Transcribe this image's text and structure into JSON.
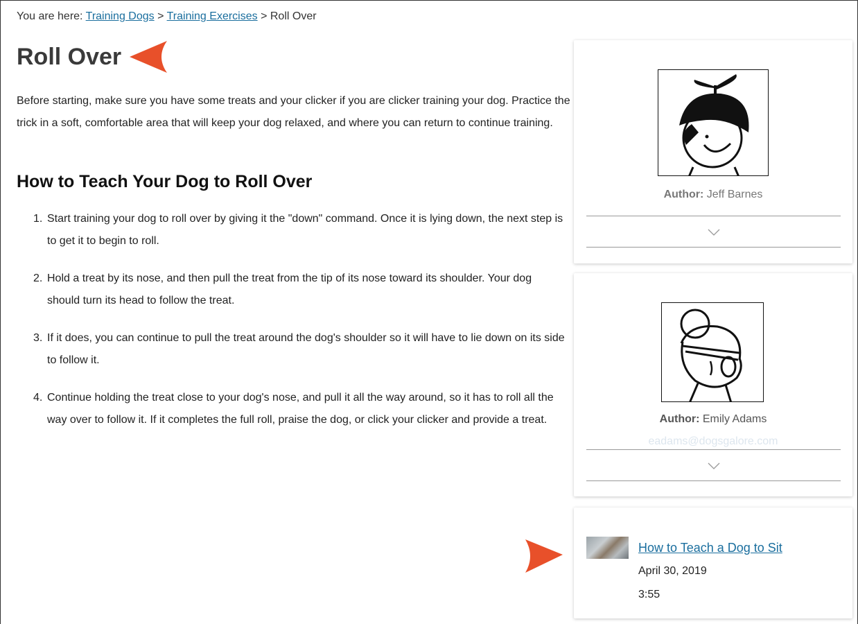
{
  "breadcrumb": {
    "prefix": "You are here: ",
    "items": [
      "Training Dogs",
      "Training Exercises",
      "Roll Over"
    ],
    "separator": " > "
  },
  "page": {
    "title": "Roll Over",
    "intro": "Before starting, make sure you have some treats and your clicker if you are clicker training your dog. Practice the trick in a soft, comfortable area that will keep your dog relaxed, and where you can return to continue training.",
    "section_heading": "How to Teach Your Dog to Roll Over",
    "steps": [
      {
        "num": "1.",
        "text": "Start training your dog to roll over by giving it the \"down\" command. Once it is lying down, the next step is to get it to begin to roll."
      },
      {
        "num": "2.",
        "text": "Hold a treat by its nose, and then pull the treat from the tip of its nose toward its shoulder. Your dog should turn its head to follow the treat."
      },
      {
        "num": "3.",
        "text": "If it does, you can continue to pull the treat around the dog's shoulder so it will have to lie down on its side to follow it."
      },
      {
        "num": "4.",
        "text": "Continue holding the treat close to your dog's nose, and pull it all the way around, so it has to roll all the way over to follow it. If it completes the full roll, praise the dog, or click your clicker and provide a treat."
      }
    ]
  },
  "authors": [
    {
      "label": "Author:",
      "name": "Jeff Barnes",
      "avatar_icon": "propeller-cap-avatar-icon"
    },
    {
      "label": "Author:",
      "name": "Emily Adams",
      "email": "eadams@dogsgalore.com",
      "avatar_icon": "woman-bun-avatar-icon"
    }
  ],
  "video": {
    "title": "How to Teach a Dog to Sit",
    "date": "April 30, 2019",
    "duration": "3:55"
  },
  "colors": {
    "accent_arrow": "#e8502a",
    "link": "#1a6e9e"
  }
}
